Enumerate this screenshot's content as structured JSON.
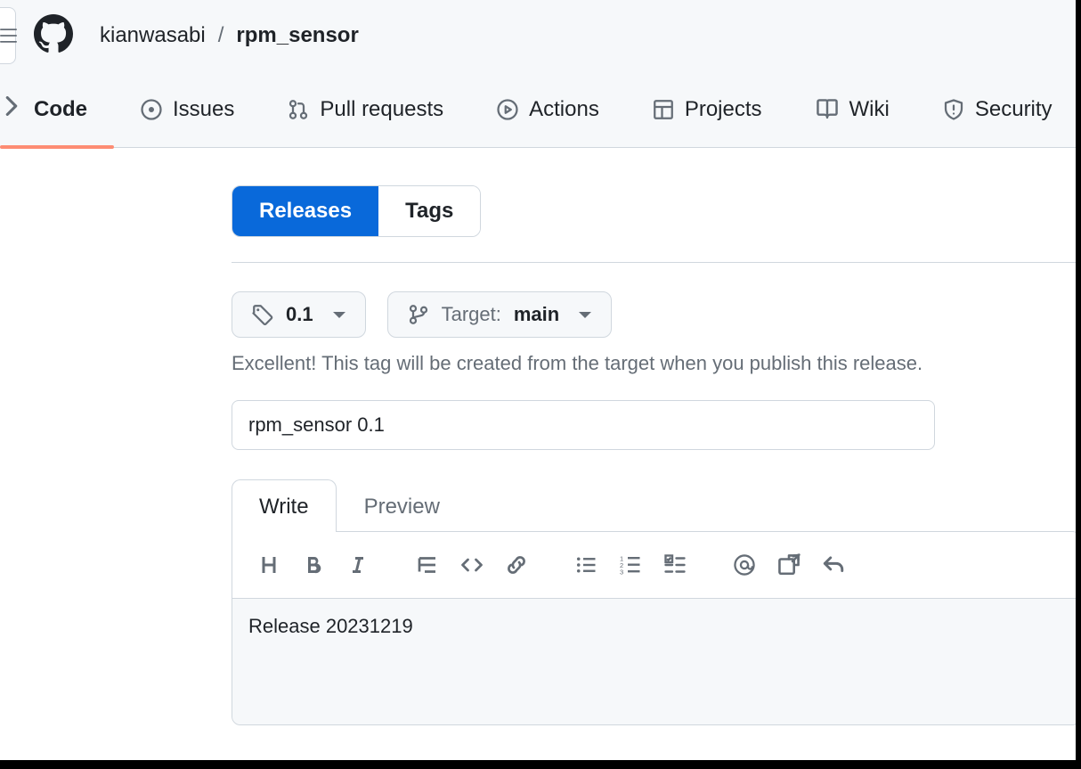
{
  "header": {
    "owner": "kianwasabi",
    "separator": "/",
    "repo": "rpm_sensor"
  },
  "nav": {
    "code": "Code",
    "issues": "Issues",
    "pulls": "Pull requests",
    "actions": "Actions",
    "projects": "Projects",
    "wiki": "Wiki",
    "security": "Security"
  },
  "release_tabs": {
    "releases": "Releases",
    "tags": "Tags"
  },
  "tag_selector": {
    "value": "0.1"
  },
  "target_selector": {
    "label": "Target:",
    "value": "main"
  },
  "hint": "Excellent! This tag will be created from the target when you publish this release.",
  "title_input": {
    "value": "rpm_sensor 0.1"
  },
  "editor": {
    "write_tab": "Write",
    "preview_tab": "Preview",
    "body": "Release 20231219"
  }
}
